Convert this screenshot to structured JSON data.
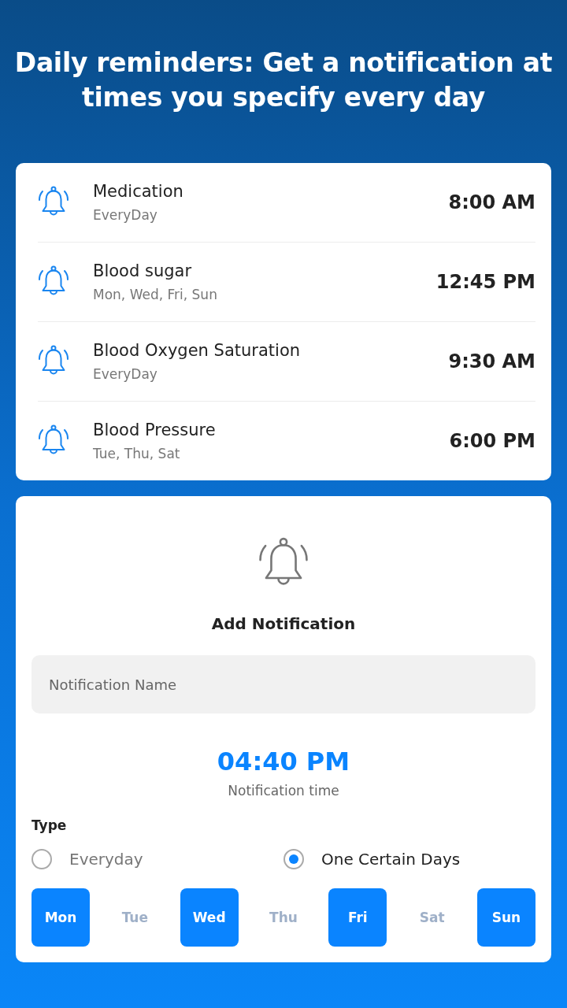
{
  "headline": "Daily reminders: Get a notification at times you specify every day",
  "reminders": [
    {
      "name": "Medication",
      "days": "EveryDay",
      "time": "8:00 AM"
    },
    {
      "name": "Blood sugar",
      "days": "Mon, Wed, Fri, Sun",
      "time": "12:45 PM"
    },
    {
      "name": "Blood Oxygen Saturation",
      "days": "EveryDay",
      "time": "9:30 AM"
    },
    {
      "name": "Blood Pressure",
      "days": "Tue, Thu, Sat",
      "time": "6:00 PM"
    }
  ],
  "add_form": {
    "title": "Add Notification",
    "name_field": {
      "placeholder": "Notification Name"
    },
    "time": "04:40 PM",
    "time_label": "Notification time",
    "type_label": "Type",
    "types": [
      {
        "label": "Everyday",
        "selected": false
      },
      {
        "label": "One Certain Days",
        "selected": true
      }
    ],
    "days": [
      {
        "label": "Mon",
        "selected": true
      },
      {
        "label": "Tue",
        "selected": false
      },
      {
        "label": "Wed",
        "selected": true
      },
      {
        "label": "Thu",
        "selected": false
      },
      {
        "label": "Fri",
        "selected": true
      },
      {
        "label": "Sat",
        "selected": false
      },
      {
        "label": "Sun",
        "selected": true
      }
    ]
  }
}
